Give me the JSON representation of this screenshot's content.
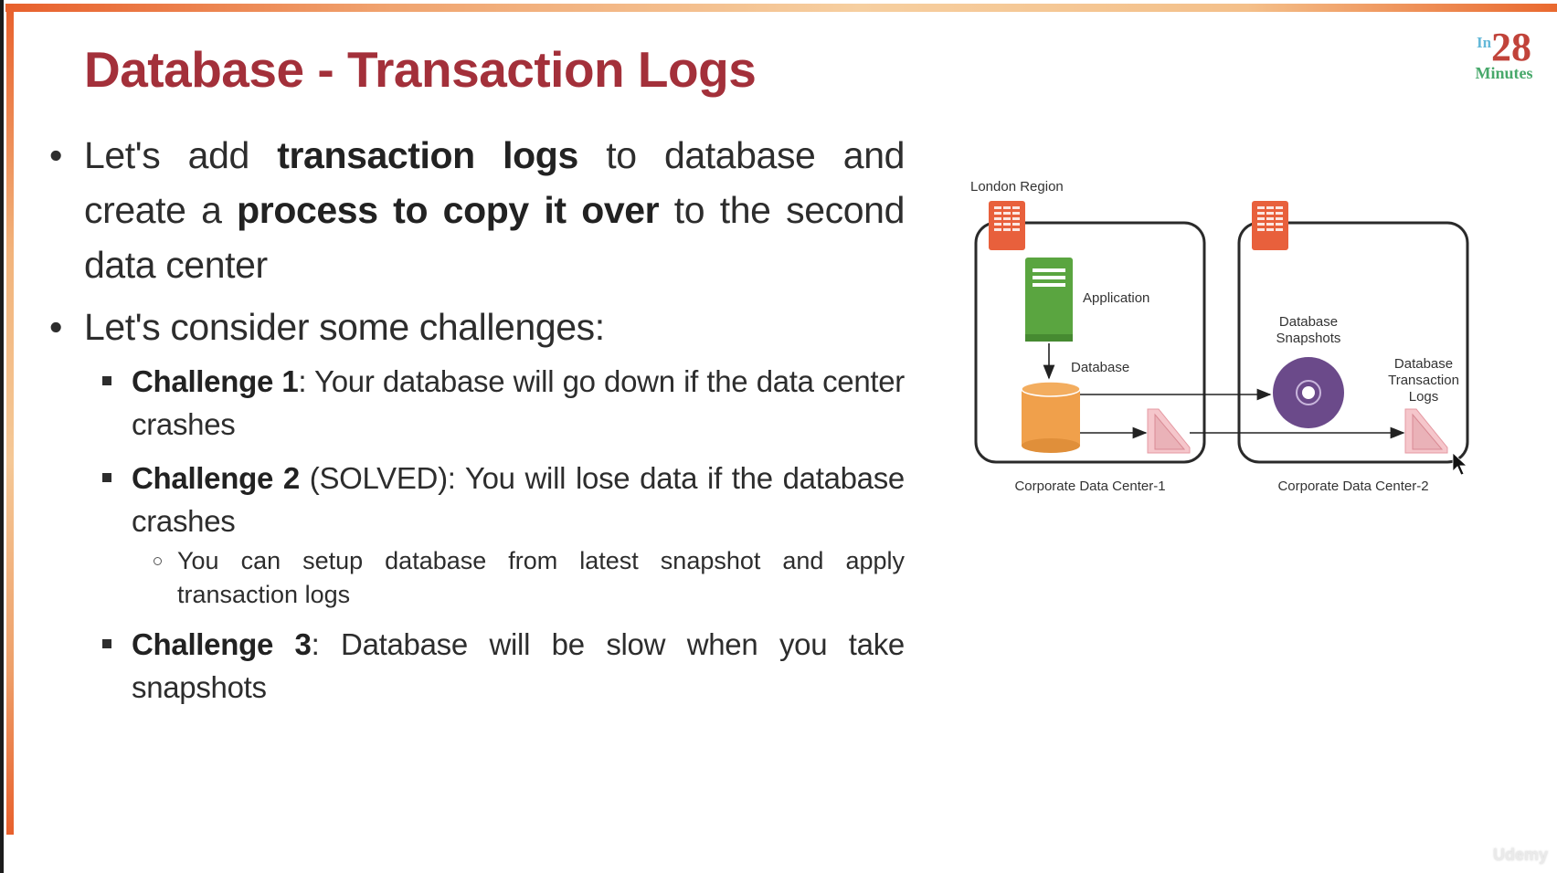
{
  "slide": {
    "title": "Database - Transaction Logs",
    "logo": {
      "prefix": "In",
      "number": "28",
      "suffix": "Minutes"
    },
    "watermark": "Udemy"
  },
  "bullets": [
    {
      "segments": [
        {
          "text": "Let's add ",
          "bold": false
        },
        {
          "text": "transaction logs",
          "bold": true
        },
        {
          "text": " to database and create a ",
          "bold": false
        },
        {
          "text": "process to copy it over",
          "bold": true
        },
        {
          "text": " to the second data center",
          "bold": false
        }
      ]
    },
    {
      "segments": [
        {
          "text": "Let's consider some challenges:",
          "bold": false
        }
      ],
      "children": [
        {
          "segments": [
            {
              "text": "Challenge 1",
              "bold": true
            },
            {
              "text": ": Your database will go down if the data center crashes",
              "bold": false
            }
          ]
        },
        {
          "segments": [
            {
              "text": "Challenge 2",
              "bold": true
            },
            {
              "text": " (SOLVED): You will lose data if the database crashes",
              "bold": false
            }
          ],
          "children": [
            {
              "text": "You can setup database from latest snapshot and apply transaction logs"
            }
          ]
        },
        {
          "segments": [
            {
              "text": "Challenge 3",
              "bold": true
            },
            {
              "text": ": Database will be slow when you take snapshots",
              "bold": false
            }
          ]
        }
      ]
    }
  ],
  "diagram": {
    "region_label": "London Region",
    "data_center_1": {
      "label": "Corporate Data Center-1",
      "application_label": "Application",
      "database_label": "Database"
    },
    "data_center_2": {
      "label": "Corporate Data Center-2",
      "snapshots_label": [
        "Database",
        "Snapshots"
      ],
      "logs_label": [
        "Database",
        "Transaction",
        "Logs"
      ]
    },
    "colors": {
      "building": "#e8603c",
      "application": "#5aa540",
      "database": "#f0a04b",
      "snapshot": "#6b4a8a",
      "log_file": "#f5c6cb"
    }
  }
}
